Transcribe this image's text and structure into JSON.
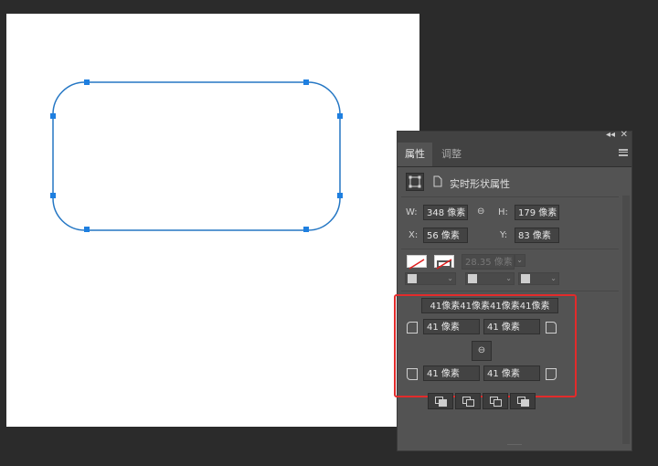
{
  "panel": {
    "collapse_glyph": "◂◂",
    "close_glyph": "✕",
    "tabs": [
      {
        "label": "属性"
      },
      {
        "label": "调整"
      }
    ],
    "header_title": "实时形状属性"
  },
  "transform": {
    "w_label": "W:",
    "w_value": "348 像素",
    "h_label": "H:",
    "h_value": "179 像素",
    "x_label": "X:",
    "x_value": "56 像素",
    "y_label": "Y:",
    "y_value": "83 像素",
    "link_glyph": "⊖"
  },
  "appearance": {
    "stroke_width": "28.35 像素"
  },
  "corners": {
    "all_radius": "41像素41像素41像素41像素",
    "top_left": "41 像素",
    "top_right": "41 像素",
    "bottom_left": "41 像素",
    "bottom_right": "41 像素",
    "link_glyph": "⊖"
  },
  "colors": {
    "shape_stroke": "#2577c4",
    "anchor": "#1e7fe0",
    "highlight": "#e22b2b"
  }
}
